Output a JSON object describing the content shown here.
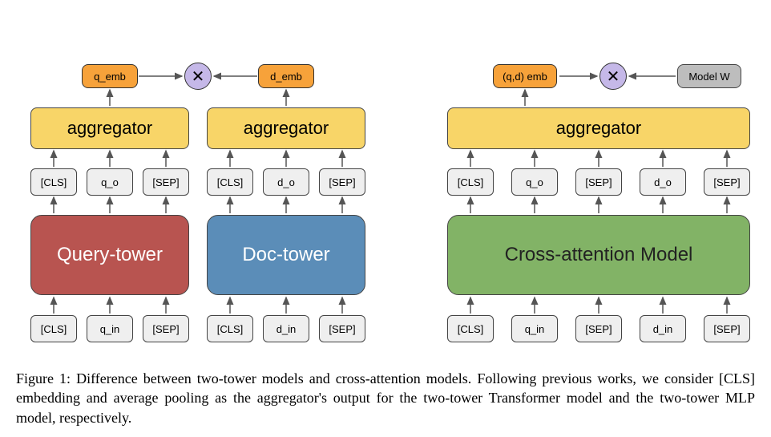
{
  "left": {
    "q_emb": "q_emb",
    "d_emb": "d_emb",
    "aggregator": "aggregator",
    "query_tower": "Query-tower",
    "doc_tower": "Doc-tower",
    "tokens_out_q": [
      "[CLS]",
      "q_o",
      "[SEP]"
    ],
    "tokens_out_d": [
      "[CLS]",
      "d_o",
      "[SEP]"
    ],
    "tokens_in_q": [
      "[CLS]",
      "q_in",
      "[SEP]"
    ],
    "tokens_in_d": [
      "[CLS]",
      "d_in",
      "[SEP]"
    ]
  },
  "right": {
    "qd_emb": "(q,d) emb",
    "model_w": "Model W",
    "aggregator": "aggregator",
    "cross_model": "Cross-attention Model",
    "tokens_out": [
      "[CLS]",
      "q_o",
      "[SEP]",
      "d_o",
      "[SEP]"
    ],
    "tokens_in": [
      "[CLS]",
      "q_in",
      "[SEP]",
      "d_in",
      "[SEP]"
    ]
  },
  "mult_symbol": "✕",
  "caption": "Figure 1: Difference between two-tower models and cross-attention models. Following previous works, we consider [CLS] embedding and average pooling as the aggregator's output for the two-tower Transformer model and the two-tower MLP model, respectively."
}
